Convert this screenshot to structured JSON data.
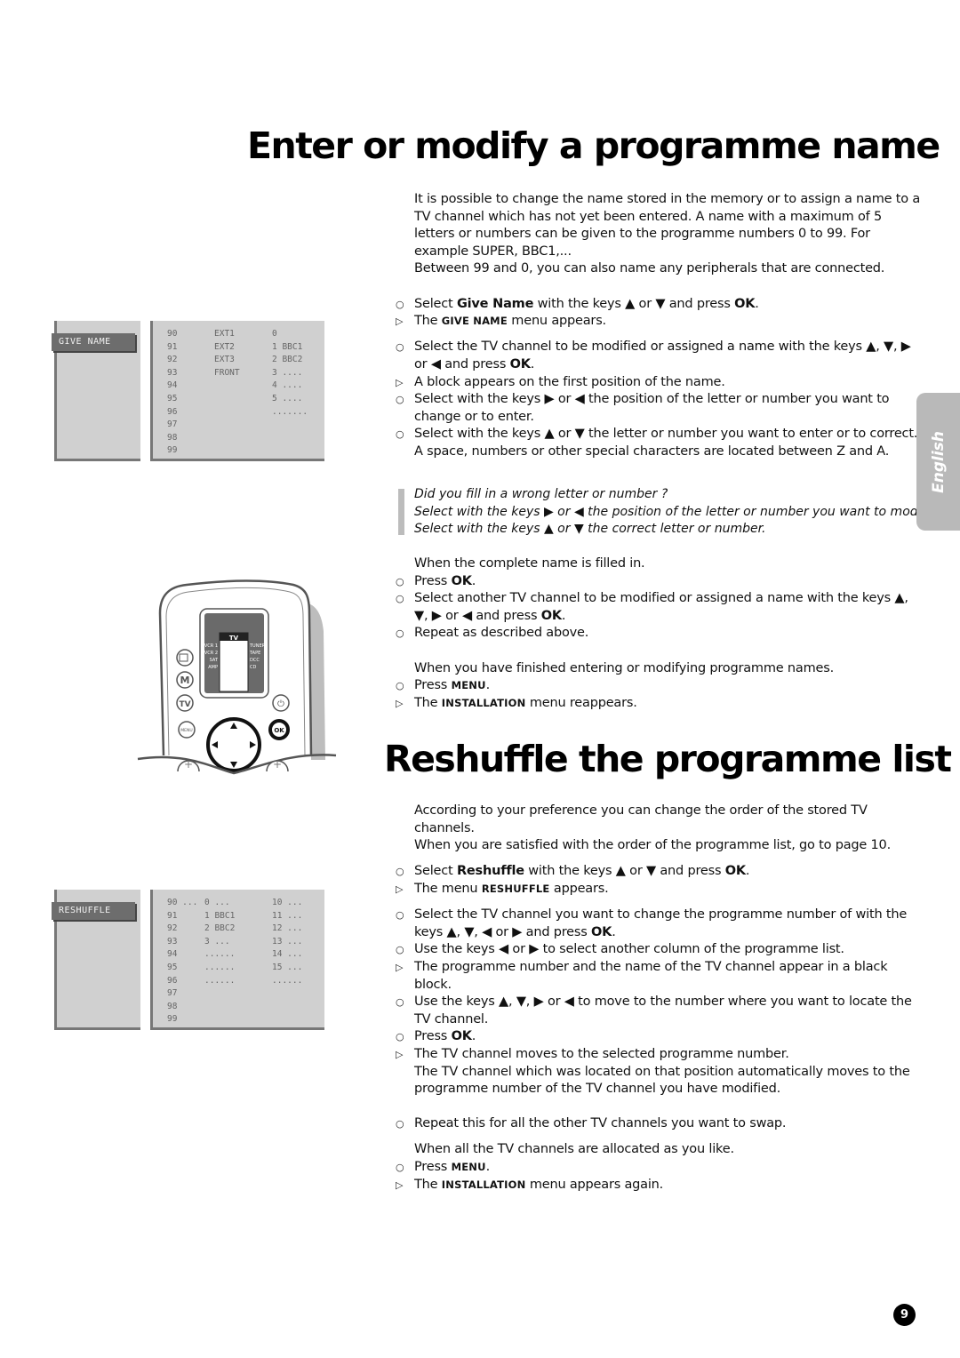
{
  "section1": {
    "title": "Enter or modify a programme name",
    "intro_1": "It is possible to change the name stored in the memory or to assign a name to a TV channel which has not yet been entered. A name with a maximum of 5 letters or numbers can be given to the programme numbers 0 to 99. For example SUPER, BBC1,...",
    "intro_2": "Between 99 and 0, you can also name any peripherals that are connected.",
    "steps": [
      {
        "marker": "○",
        "pre": "Select ",
        "bold": "Give Name",
        "post": " with the keys ▲ or ▼ and press ",
        "bold2": "OK",
        "end": "."
      },
      {
        "marker": "▷",
        "pre": "The ",
        "sc": "GIVE NAME",
        "post": " menu appears."
      },
      {
        "marker": "○",
        "text": "Select the TV channel to be modified or assigned a name with the keys ▲, ▼, ▶ or ◀ and press ",
        "bold": "OK",
        "end": "."
      },
      {
        "marker": "▷",
        "text": "A block appears on the first position of the name."
      },
      {
        "marker": "○",
        "text": "Select with the keys ▶ or ◀ the position of the letter or number you want to change or to enter."
      },
      {
        "marker": "○",
        "text": "Select with the keys ▲ or ▼ the letter or number you want to enter or to correct. A space, numbers or other special characters are located between Z and A."
      }
    ],
    "note": {
      "line1": "Did you fill in a wrong letter or number ?",
      "line2": "Select with the keys ▶ or ◀ the position of the letter or number you want to modify.",
      "line3": "Select with the keys ▲ or ▼ the correct letter or number."
    },
    "complete_text": "When the complete name is filled in.",
    "steps2": [
      {
        "marker": "○",
        "pre": "Press ",
        "bold": "OK",
        "end": "."
      },
      {
        "marker": "○",
        "text": "Select another TV channel to be modified or assigned a name with the keys ▲, ▼, ▶ or ◀ and press ",
        "bold": "OK",
        "end": "."
      },
      {
        "marker": "○",
        "text": "Repeat as described above."
      }
    ],
    "finished_text": "When you have finished entering or modifying programme names.",
    "steps3": [
      {
        "marker": "○",
        "pre": "Press ",
        "sc": "MENU",
        "end": "."
      },
      {
        "marker": "▷",
        "pre": "The ",
        "sc": "INSTALLATION",
        "post": " menu reappears."
      }
    ]
  },
  "osd_give_name": {
    "tag": "GIVE NAME",
    "col1": [
      "90",
      "91",
      "92",
      "93",
      "94",
      "95",
      "96",
      "97",
      "98",
      "99"
    ],
    "col2": [
      "EXT1",
      "EXT2",
      "EXT3",
      "FRONT"
    ],
    "col3": [
      "0",
      "1 BBC1",
      "2 BBC2",
      "3 ....",
      "4 ....",
      "5 ....",
      "......."
    ]
  },
  "remote": {
    "display_header": "TV",
    "left_labels": [
      "VCR 1",
      "VCR 2",
      "SAT",
      "AMP"
    ],
    "right_labels": [
      "TUNER",
      "TAPE",
      "DCC",
      "CD"
    ],
    "buttons": {
      "m": "M",
      "tv": "TV",
      "menu": "MENU",
      "ok": "OK"
    }
  },
  "section2": {
    "title": "Reshuffle the programme list",
    "intro_1": "According to your preference you can change the order of the stored TV channels.",
    "intro_2": "When you are satisfied with the order of the programme list, go to page 10.",
    "steps": [
      {
        "marker": "○",
        "pre": "Select ",
        "bold": "Reshuffle",
        "post": " with the keys ▲ or ▼ and press ",
        "bold2": "OK",
        "end": "."
      },
      {
        "marker": "▷",
        "pre": "The menu ",
        "sc": "RESHUFFLE",
        "post": " appears."
      },
      {
        "marker": "○",
        "text": "Select the TV channel you want to change the programme number of with the keys ▲, ▼, ◀ or ▶ and press ",
        "bold": "OK",
        "end": "."
      },
      {
        "marker": "○",
        "text": "Use the keys ◀ or ▶ to select another column of the programme list."
      },
      {
        "marker": "▷",
        "text": "The programme number and the name of the TV channel appear in a black block."
      },
      {
        "marker": "○",
        "text": "Use the keys ▲, ▼, ▶ or ◀ to move to the number where you want to locate the TV channel."
      },
      {
        "marker": "○",
        "pre": "Press ",
        "bold": "OK",
        "end": "."
      },
      {
        "marker": "▷",
        "text": "The TV channel moves to the selected programme number."
      },
      {
        "marker": "",
        "text": "The TV channel which was located on that position automatically moves to the programme number of the TV channel you have modified."
      }
    ],
    "repeat": {
      "marker": "○",
      "text": "Repeat this for all the other TV channels you want to swap."
    },
    "allocated_text": "When all the TV channels are allocated as you like.",
    "steps3": [
      {
        "marker": "○",
        "pre": "Press ",
        "sc": "MENU",
        "end": "."
      },
      {
        "marker": "▷",
        "pre": "The ",
        "sc": "INSTALLATION",
        "post": " menu appears again."
      }
    ]
  },
  "osd_reshuffle": {
    "tag": "RESHUFFLE",
    "col1": [
      "90 ...",
      "91",
      "92",
      "93",
      "94",
      "95",
      "96",
      "97",
      "98",
      "99"
    ],
    "col2": [
      "0 ...",
      "1 BBC1",
      "2 BBC2",
      "3 ...",
      "......",
      "......",
      "......"
    ],
    "col3": [
      "10 ...",
      "11 ...",
      "12 ...",
      "13 ...",
      "14 ...",
      "15 ...",
      "......"
    ]
  },
  "language_tab": "English",
  "page_number": "9"
}
